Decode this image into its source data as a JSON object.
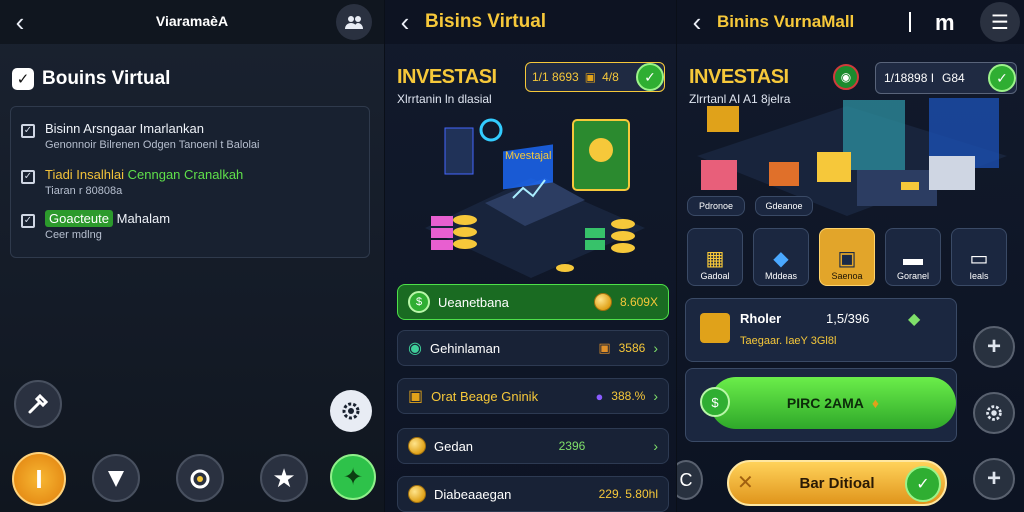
{
  "panel1": {
    "header_title": "ViaramaèA",
    "section_title": "Bouins Virtual",
    "tasks": [
      {
        "title": "Bisinn Arsngaar Imarlankan",
        "subtitle": "Genonnoir Bilrenen Odgen Tanoenl t Balolai"
      },
      {
        "title_a": "Tiadi Insalhlai",
        "title_b": "Cenngan Cranalkah",
        "subtitle": "Tiaran r 80808a"
      },
      {
        "title_a": "Goacteute",
        "title_b": "Mahalam",
        "subtitle": "Ceer mdlng"
      }
    ]
  },
  "panel2": {
    "header_title": "Bisins Virtual",
    "invest_title": "INVESTASI",
    "invest_subtitle": "Xlrrtanin ln dlasial",
    "balance": "1/1 8693",
    "balance2": "4/8",
    "screen_label": "Mvestajal",
    "rows": [
      {
        "label": "Ueanetbana",
        "value": "8.609X",
        "active": true
      },
      {
        "label": "Gehinlaman",
        "value": "3586",
        "active": false
      },
      {
        "label": "Orat Beage Gninik",
        "value": "388.%",
        "active": false
      },
      {
        "label": "Gedan",
        "value": "2396",
        "active": false
      },
      {
        "label": "Diabeaaegan",
        "value": "229. 5.80hl",
        "active": false
      }
    ]
  },
  "panel3": {
    "header_title": "Binins VurnaMall",
    "invest_title": "INVESTASI",
    "invest_subtitle": "Zlrrtanl AI A1 8jelra",
    "balance": "1/18898 I",
    "balance2": "G84",
    "iso_labels": [
      "Pdronoe",
      "Gdeanoe"
    ],
    "categories": [
      "Gadoal",
      "Mddeas",
      "Saenoa",
      "Goranel",
      "Ieals"
    ],
    "profit_title": "Rholer",
    "profit_value": "1,5/396",
    "profit_sub": "Taegaar. IaeY 3Gl8l",
    "claim_label": "PIRC 2AMA",
    "bottom_label": "Bar Ditioal"
  },
  "colors": {
    "gold": "#f6c83a",
    "green": "#3fcf3a",
    "bg": "#0d1424"
  }
}
